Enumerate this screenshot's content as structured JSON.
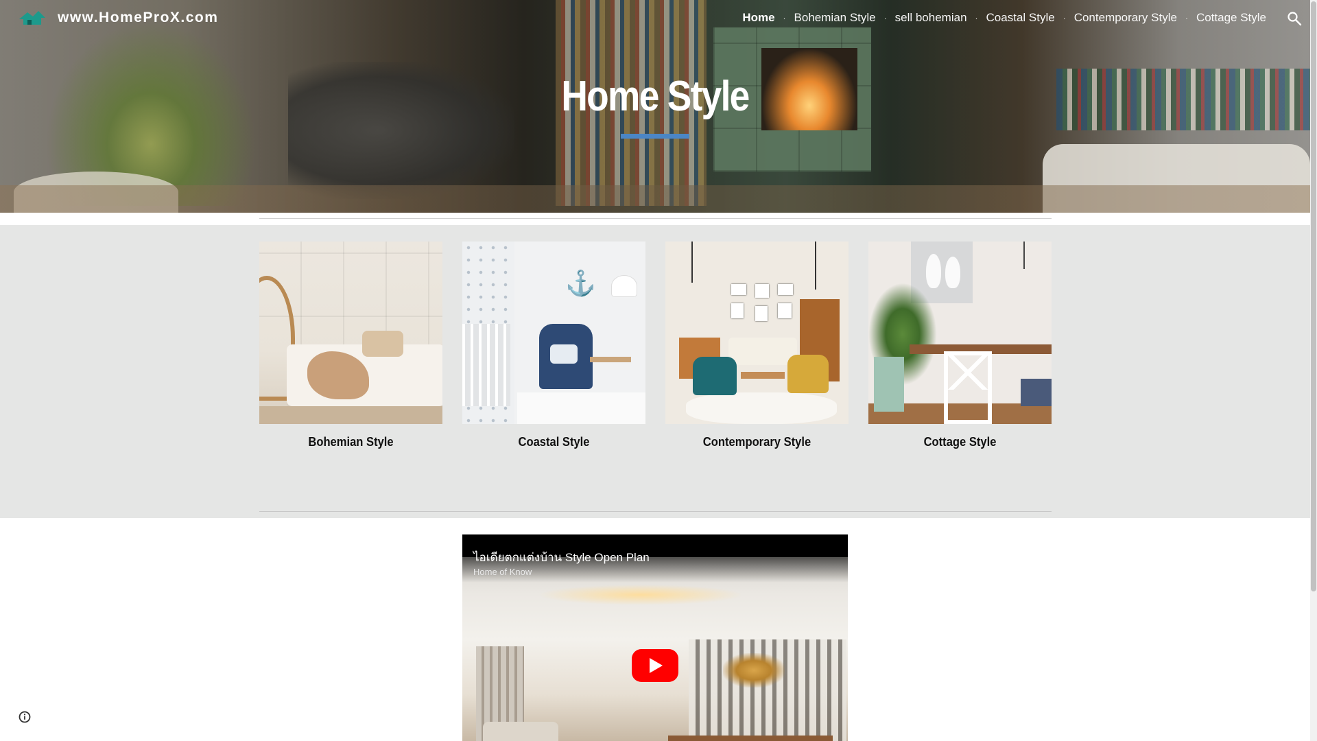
{
  "site": {
    "title": "www.HomeProX.com"
  },
  "nav": {
    "items": [
      {
        "label": "Home",
        "active": true
      },
      {
        "label": "Bohemian Style",
        "active": false
      },
      {
        "label": "sell bohemian",
        "active": false
      },
      {
        "label": "Coastal Style",
        "active": false
      },
      {
        "label": "Contemporary Style",
        "active": false
      },
      {
        "label": "Cottage Style",
        "active": false
      }
    ],
    "separator": "·",
    "search_icon": "search-icon"
  },
  "hero": {
    "title": "Home Style",
    "underline_color": "#4b86c5"
  },
  "cards": [
    {
      "label": "Bohemian Style"
    },
    {
      "label": "Coastal Style"
    },
    {
      "label": "Contemporary Style"
    },
    {
      "label": "Cottage Style"
    }
  ],
  "video": {
    "title": "ไอเดียตกแต่งบ้าน Style Open Plan",
    "channel": "Home of Know",
    "play_icon": "play-icon"
  },
  "footer": {
    "info_icon": "info-icon"
  },
  "colors": {
    "section_gray": "#e5e6e5",
    "accent": "#4b86c5",
    "youtube_red": "#ff0000"
  }
}
